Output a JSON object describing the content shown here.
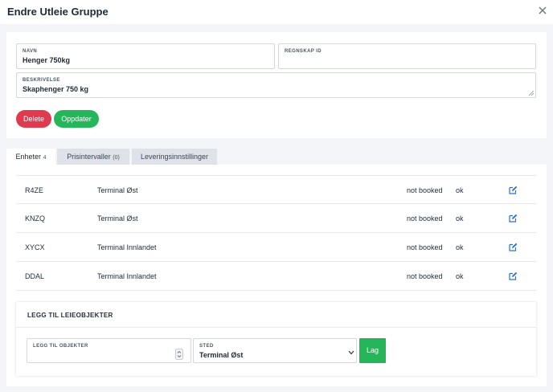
{
  "dialog": {
    "title": "Endre Utleie Gruppe"
  },
  "form": {
    "name_label": "NAVN",
    "name_value": "Henger 750kg",
    "accounting_label": "REGNSKAP ID",
    "accounting_value": "",
    "description_label": "BESKRIVELSE",
    "description_value": "Skaphenger 750 kg",
    "delete_label": "Delete",
    "update_label": "Oppdater"
  },
  "tabs": [
    {
      "label": "Enheter",
      "count": "4"
    },
    {
      "label": "Prisintervaller",
      "count": "(0)"
    },
    {
      "label": "Leveringsinnstillinger",
      "count": ""
    }
  ],
  "units": [
    {
      "code": "R4ZE",
      "location": "Terminal Øst",
      "booking": "not booked",
      "status": "ok"
    },
    {
      "code": "KNZQ",
      "location": "Terminal Øst",
      "booking": "not booked",
      "status": "ok"
    },
    {
      "code": "XYCX",
      "location": "Terminal Innlandet",
      "booking": "not booked",
      "status": "ok"
    },
    {
      "code": "DDAL",
      "location": "Terminal Innlandet",
      "booking": "not booked",
      "status": "ok"
    }
  ],
  "add_objects": {
    "title": "LEGG TIL LEIEOBJEKTER",
    "count_label": "LEGG TIL OBJEKTER",
    "count_value": "",
    "location_label": "STED",
    "location_value": "Terminal Øst",
    "create_label": "Lag"
  },
  "colors": {
    "danger": "#df3a4e",
    "success": "#26b65a",
    "accent": "#2b6fd6"
  }
}
